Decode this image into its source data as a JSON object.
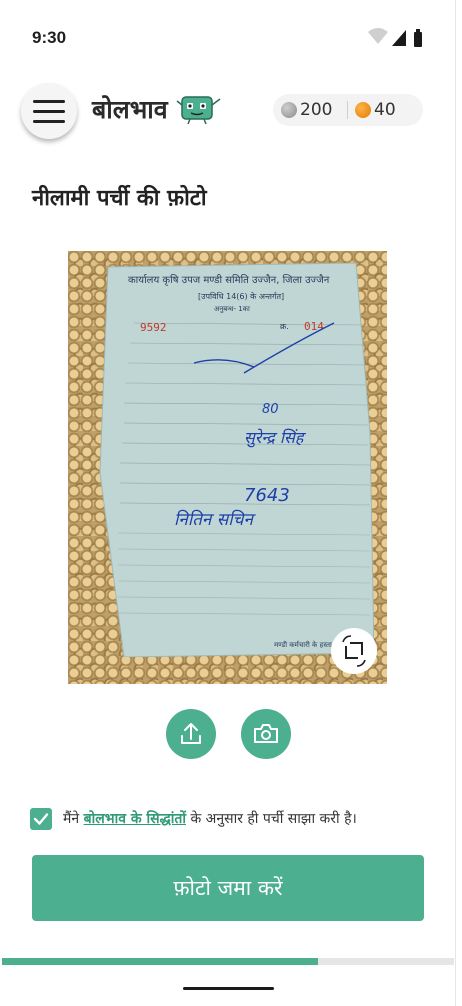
{
  "status_bar": {
    "time": "9:30",
    "icons": [
      "wifi-icon",
      "signal-icon",
      "battery-icon"
    ]
  },
  "header": {
    "app_name": "बोलभाव",
    "menu_icon": "hamburger-menu-icon",
    "mascot_icon": "mascot-logo-icon",
    "coins": {
      "silver": {
        "icon": "silver-coin-icon",
        "value": "200"
      },
      "gold": {
        "icon": "gold-coin-icon",
        "value": "40"
      }
    }
  },
  "page": {
    "title": "नीलामी पर्ची की फ़ोटो"
  },
  "photo": {
    "rotate_icon": "crop-rotate-icon",
    "slip": {
      "heading": "कार्यालय कृषि उपज मण्डी समिति उज्जैन, जिला उज्जैन",
      "subheading": "[उपविधि 14(6) के अन्तर्गत]",
      "anubandh": "अनुबन्ध- 1का",
      "serial_label": "क्र.",
      "serial_no": "014",
      "number": "9592",
      "handwritten_1": "80",
      "handwritten_2": "सुरेन्द्र सिंह",
      "handwritten_3": "7643",
      "handwritten_4": "नितिन सचिन",
      "footer": "मण्डी कर्मचारी के हस्ताक्षर"
    }
  },
  "actions": {
    "upload_icon": "upload-icon",
    "camera_icon": "camera-icon"
  },
  "consent": {
    "prefix": "मैंने",
    "link": "बोलभाव के सिद्धांतों",
    "suffix": "के अनुसार ही पर्ची साझा करी है।",
    "checked": true
  },
  "submit": {
    "label": "फ़ोटो जमा करें"
  },
  "progress": {
    "fraction": 0.7
  },
  "colors": {
    "accent": "#4caf8f",
    "link": "#2f9a78",
    "slip": "#bfd6d5"
  }
}
